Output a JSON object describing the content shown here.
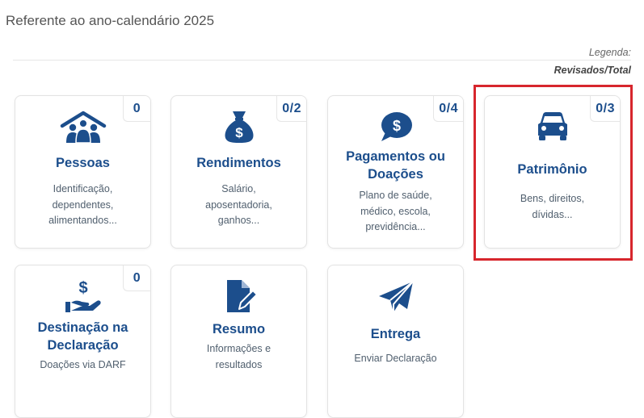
{
  "heading": "Referente ao ano-calendário 2025",
  "legend": {
    "label": "Legenda:",
    "value": "Revisados/Total"
  },
  "colors": {
    "primary": "#1c4e8c",
    "highlight": "#d7262d"
  },
  "cards": [
    {
      "id": "pessoas",
      "count": "0",
      "title_lines": [
        "Pessoas"
      ],
      "desc_lines": [
        "Identificação,",
        "dependentes,",
        "alimentandos..."
      ],
      "icon": "people-house-icon"
    },
    {
      "id": "rendimentos",
      "count": "0/2",
      "title_lines": [
        "Rendimentos"
      ],
      "desc_lines": [
        "Salário,",
        "aposentadoria,",
        "ganhos..."
      ],
      "icon": "money-bag-icon"
    },
    {
      "id": "pagamentos",
      "count": "0/4",
      "title_lines": [
        "Pagamentos ou",
        "Doações"
      ],
      "desc_lines": [
        "Plano de saúde,",
        "médico, escola,",
        "previdência..."
      ],
      "icon": "money-chat-bubble-icon"
    },
    {
      "id": "patrimonio",
      "count": "0/3",
      "title_lines": [
        "Patrimônio"
      ],
      "desc_lines": [
        "Bens, direitos,",
        "dívidas..."
      ],
      "icon": "car-icon"
    },
    {
      "id": "destinacao",
      "count": "0",
      "title_lines": [
        "Destinação na",
        "Declaração"
      ],
      "desc_lines": [
        "Doações via DARF"
      ],
      "icon": "hand-money-icon"
    },
    {
      "id": "resumo",
      "count": "",
      "title_lines": [
        "Resumo"
      ],
      "desc_lines": [
        "Informações e",
        "resultados"
      ],
      "icon": "document-edit-icon"
    },
    {
      "id": "entrega",
      "count": "",
      "title_lines": [
        "Entrega"
      ],
      "desc_lines": [
        "Enviar Declaração"
      ],
      "icon": "paper-plane-icon"
    }
  ]
}
